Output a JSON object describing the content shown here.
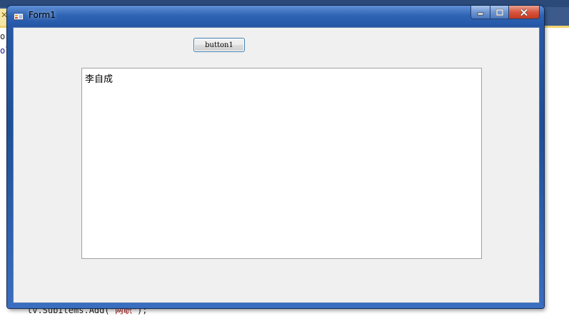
{
  "window": {
    "title": "Form1"
  },
  "form": {
    "button1_label": "button1",
    "textbox_text": "李自成"
  },
  "background": {
    "code_line_top": "or",
    "code_line_2": "ol",
    "code_line_bottom_prefix": "lv.SubItems.Add(",
    "code_line_bottom_string": "\"两职\"",
    "code_line_bottom_suffix": ");"
  },
  "colors": {
    "titlebar": "#2e63b3",
    "client_bg": "#f0f0f0",
    "close_button": "#d8543e"
  },
  "icons": {
    "window_icon": "form-icon",
    "minimize": "minimize-icon",
    "maximize": "maximize-icon",
    "close": "close-icon"
  }
}
